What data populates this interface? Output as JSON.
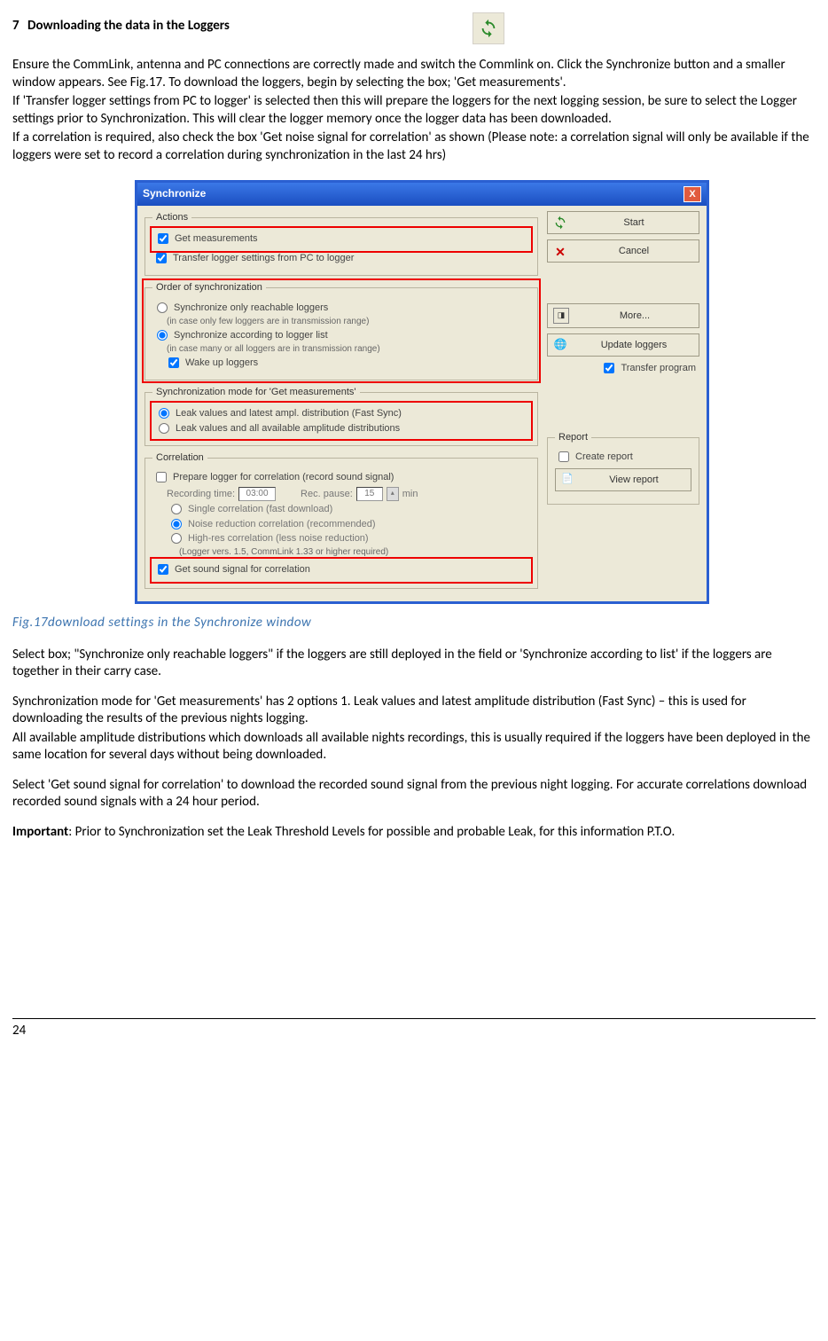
{
  "heading": {
    "number": "7",
    "title": "Downloading the data in the Loggers"
  },
  "intro": {
    "p1": "Ensure the CommLink, antenna and PC connections are correctly made and switch the Commlink on. Click the Synchronize button and a smaller window appears. See Fig.17. To download the loggers, begin by selecting the box; 'Get measurements'.",
    "p2": "If 'Transfer logger settings from PC to logger' is selected then this will prepare the loggers for the next logging session, be sure to select the Logger settings prior to Synchronization. This will clear the logger memory once the logger data has been downloaded.",
    "p3": "If a correlation is required, also check the box 'Get noise signal for correlation' as shown (Please note:  a correlation signal will only be available if the loggers were set to record a correlation during synchronization in the last 24 hrs)"
  },
  "dialog": {
    "title": "Synchronize",
    "actions": {
      "legend": "Actions",
      "get_measurements": "Get measurements",
      "transfer": "Transfer logger settings from PC to logger"
    },
    "order": {
      "legend": "Order of synchronization",
      "opt1": "Synchronize only reachable loggers",
      "opt1_sub": "(in case only few loggers are in transmission range)",
      "opt2": "Synchronize according to logger list",
      "opt2_sub": "(in case many or all loggers are in transmission range)",
      "wake": "Wake up loggers"
    },
    "mode": {
      "legend": "Synchronization mode for 'Get measurements'",
      "opt1": "Leak values and latest ampl. distribution (Fast Sync)",
      "opt2": "Leak values and all available amplitude distributions"
    },
    "corr": {
      "legend": "Correlation",
      "prepare": "Prepare logger for correlation (record sound signal)",
      "rec_time_lbl": "Recording time:",
      "rec_time_val": "03:00",
      "rec_pause_lbl": "Rec. pause:",
      "rec_pause_val": "15",
      "rec_pause_unit": "min",
      "single": "Single correlation (fast download)",
      "noise": "Noise reduction correlation (recommended)",
      "highres": "High-res correlation (less noise reduction)",
      "note": "(Logger vers. 1.5, CommLink 1.33 or higher required)",
      "get_sound": "Get sound signal for correlation"
    },
    "buttons": {
      "start": "Start",
      "cancel": "Cancel",
      "more": "More...",
      "update": "Update loggers",
      "transfer_prog": "Transfer program"
    },
    "report": {
      "legend": "Report",
      "create": "Create report",
      "view": "View report"
    }
  },
  "caption": "Fig.17download settings in the Synchronize window",
  "body": {
    "p1": "Select box; \"Synchronize only reachable loggers\" if the loggers are still deployed in the field or 'Synchronize according to list' if the loggers are together in their carry case.",
    "p2": "Synchronization mode for 'Get measurements' has 2 options 1. Leak values and latest amplitude distribution (Fast Sync) – this is used for downloading the results of the previous nights logging.",
    "p3": "All available amplitude distributions which downloads all available nights recordings, this is usually required if the loggers have been deployed in the same location for several days without being downloaded.",
    "p4": "Select 'Get sound signal for correlation' to download the recorded sound signal from the previous night logging. For accurate correlations download recorded sound signals with a 24 hour period.",
    "important_label": "Important",
    "p5_rest": ": Prior to Synchronization  set the Leak Threshold Levels for possible and probable Leak, for this information P.T.O."
  },
  "page_number": "24"
}
